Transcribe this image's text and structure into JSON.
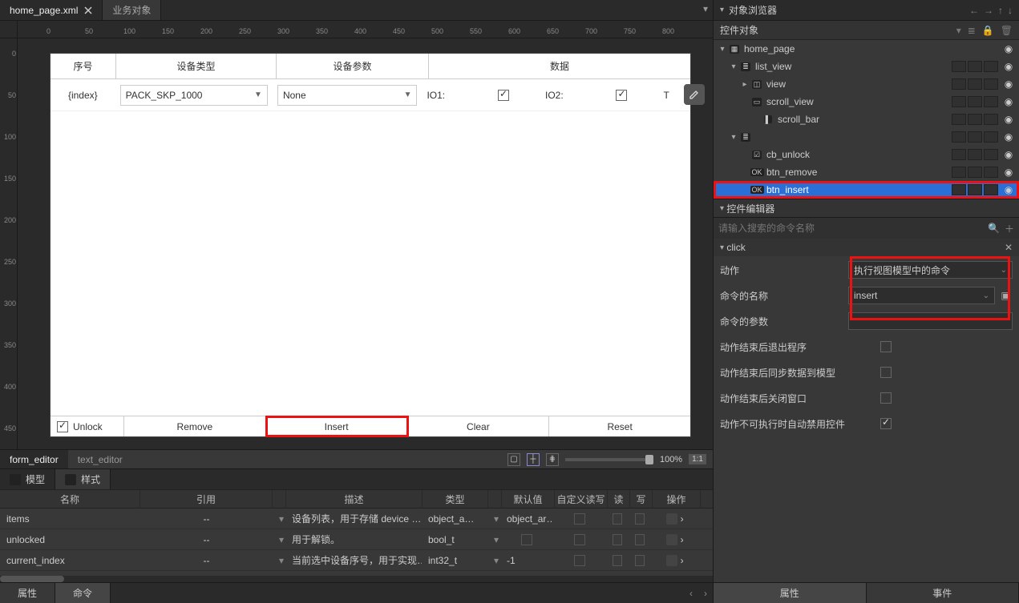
{
  "tabs": {
    "file": "home_page.xml",
    "biz": "业务对象"
  },
  "ruler_h": [
    "0",
    "50",
    "100",
    "150",
    "200",
    "250",
    "300",
    "350",
    "400",
    "450",
    "500",
    "550",
    "600",
    "650",
    "700",
    "750",
    "800"
  ],
  "ruler_v": [
    "0",
    "50",
    "100",
    "150",
    "200",
    "250",
    "300",
    "350",
    "400",
    "450"
  ],
  "canvas": {
    "headers": [
      "序号",
      "设备类型",
      "设备参数",
      "",
      "",
      "数据",
      "",
      ""
    ],
    "row": {
      "index": "{index}",
      "device_type": "PACK_SKP_1000",
      "device_param": "None",
      "io1": "IO1:",
      "io2": "IO2:",
      "t": "T"
    },
    "bottom": {
      "unlock": "Unlock",
      "remove": "Remove",
      "insert": "Insert",
      "clear": "Clear",
      "reset": "Reset"
    }
  },
  "editor_footer": {
    "form": "form_editor",
    "text": "text_editor",
    "zoom": "100%",
    "one_one": "1:1"
  },
  "ms_tabs": {
    "model": "模型",
    "style": "样式"
  },
  "model_table": {
    "headers": {
      "name": "名称",
      "ref": "引用",
      "desc": "描述",
      "type": "类型",
      "def": "默认值",
      "custom": "自定义读写",
      "read": "读",
      "write": "写",
      "op": "操作"
    },
    "rows": [
      {
        "name": "items",
        "ref": "--",
        "desc": "设备列表，用于存储 device …",
        "type": "object_a…",
        "def": "object_ar…"
      },
      {
        "name": "unlocked",
        "ref": "--",
        "desc": "用于解锁。",
        "type": "bool_t",
        "def": ""
      },
      {
        "name": "current_index",
        "ref": "--",
        "desc": "当前选中设备序号，用于实现…",
        "type": "int32_t",
        "def": "-1"
      }
    ]
  },
  "bottom_tabs": {
    "prop": "属性",
    "cmd": "命令"
  },
  "right": {
    "browser_title": "对象浏览器",
    "widgets_title": "控件对象",
    "tree": [
      {
        "ind": 0,
        "arrow": "▾",
        "icon": "folder",
        "label": "home_page",
        "eye": true
      },
      {
        "ind": 1,
        "arrow": "▾",
        "icon": "list",
        "label": "list_view",
        "eye": true,
        "slots": 3
      },
      {
        "ind": 2,
        "arrow": "▸",
        "icon": "view",
        "label": "view",
        "eye": true,
        "slots": 3
      },
      {
        "ind": 2,
        "arrow": "",
        "icon": "scroll",
        "label": "scroll_view",
        "eye": true,
        "slots": 3
      },
      {
        "ind": 3,
        "arrow": "",
        "icon": "bar",
        "label": "scroll_bar",
        "eye": true,
        "slots": 3
      },
      {
        "ind": 1,
        "arrow": "▾",
        "icon": "list",
        "label": "",
        "eye": true,
        "slots": 3
      },
      {
        "ind": 2,
        "arrow": "",
        "icon": "cb",
        "label": "cb_unlock",
        "eye": true,
        "slots": 3
      },
      {
        "ind": 2,
        "arrow": "",
        "icon": "btn",
        "label": "btn_remove",
        "eye": true,
        "slots": 3
      },
      {
        "ind": 2,
        "arrow": "",
        "icon": "btn",
        "label": "btn_insert",
        "eye": true,
        "slots": 3,
        "selected": true,
        "highlight": true
      }
    ],
    "editor_title": "控件编辑器",
    "search_placeholder": "请输入搜索的命令名称",
    "event_name": "click",
    "form": {
      "action_label": "动作",
      "action_value": "执行视图模型中的命令",
      "cmd_name_label": "命令的名称",
      "cmd_name_value": "insert",
      "cmd_args_label": "命令的参数",
      "exit_label": "动作结束后退出程序",
      "sync_label": "动作结束后同步数据到模型",
      "close_label": "动作结束后关闭窗口",
      "disable_label": "动作不可执行时自动禁用控件"
    },
    "bottom_tabs": {
      "prop": "属性",
      "event": "事件"
    }
  }
}
